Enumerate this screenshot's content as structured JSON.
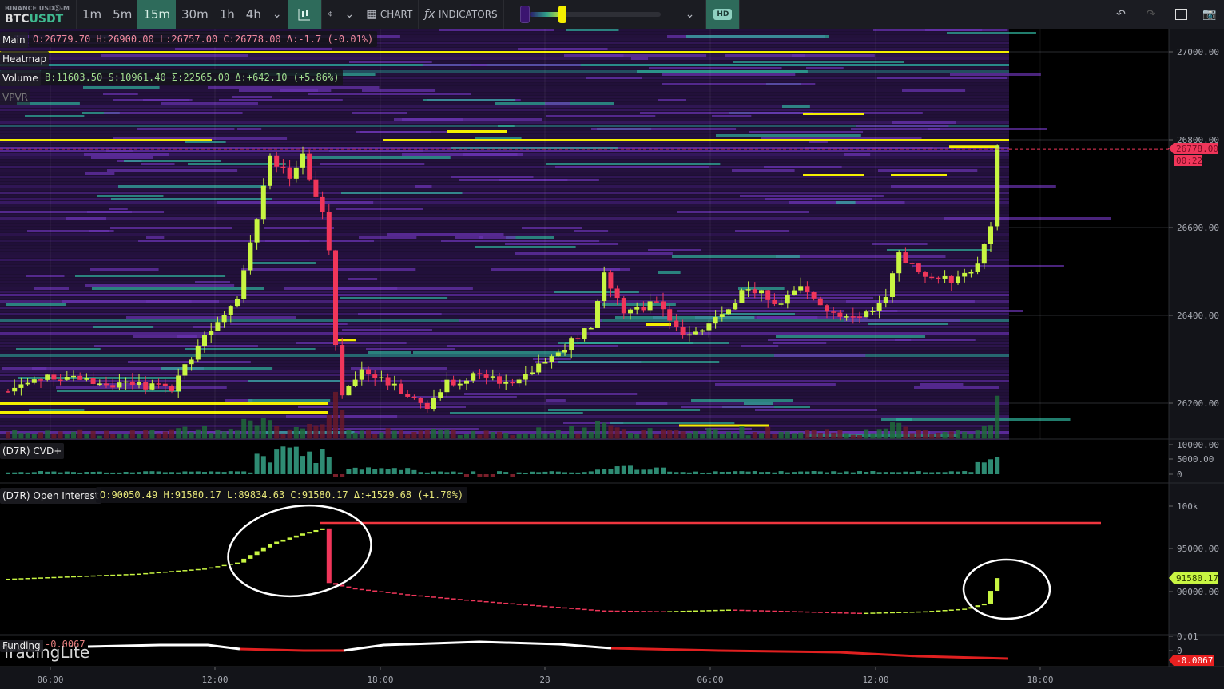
{
  "toolbar": {
    "exchange": "BINANCE USDⓈ-M",
    "symbol_base": "BTC",
    "symbol_quote": "USDT",
    "timeframes": [
      "1m",
      "5m",
      "15m",
      "30m",
      "1h",
      "4h"
    ],
    "active_timeframe": "15m",
    "chart_label": "CHART",
    "indicators_label": "INDICATORS",
    "hd_label": "HD",
    "heatmap_slider_value": 0.25
  },
  "main": {
    "label": "Main",
    "ohlc": "O:26779.70 H:26900.00 L:26757.00 C:26778.00 Δ:-1.7 (-0.01%)",
    "heatmap_label": "Heatmap",
    "volume_label": "Volume",
    "volume_values": "B:11603.50 S:10961.40 Σ:22565.00 Δ:+642.10 (+5.86%)",
    "vpvr_label": "VPVR",
    "price_ticks": [
      "27000.00",
      "26800.00",
      "26600.00",
      "26400.00",
      "26200.00"
    ],
    "last_price": "26778.00",
    "countdown": "00:22",
    "price_keypoints": [
      [
        0,
        26227
      ],
      [
        6,
        26264
      ],
      [
        17,
        26242
      ],
      [
        25,
        26236
      ],
      [
        30,
        26355
      ],
      [
        35,
        26445
      ],
      [
        38,
        26627
      ],
      [
        40,
        26755
      ],
      [
        43,
        26718
      ],
      [
        45,
        26760
      ],
      [
        48,
        26627
      ],
      [
        49,
        26555
      ],
      [
        50,
        26336
      ],
      [
        51,
        26209
      ],
      [
        54,
        26282
      ],
      [
        60,
        26227
      ],
      [
        64,
        26190
      ],
      [
        67,
        26245
      ],
      [
        72,
        26264
      ],
      [
        77,
        26245
      ],
      [
        84,
        26318
      ],
      [
        89,
        26373
      ],
      [
        91,
        26500
      ],
      [
        94,
        26409
      ],
      [
        99,
        26427
      ],
      [
        103,
        26355
      ],
      [
        107,
        26373
      ],
      [
        113,
        26464
      ],
      [
        118,
        26427
      ],
      [
        121,
        26464
      ],
      [
        125,
        26409
      ],
      [
        130,
        26391
      ],
      [
        134,
        26445
      ],
      [
        136,
        26536
      ],
      [
        140,
        26482
      ],
      [
        145,
        26482
      ],
      [
        148,
        26518
      ],
      [
        150,
        26609
      ],
      [
        151,
        26778
      ]
    ]
  },
  "cvd": {
    "label": "(D7R) CVD+",
    "ticks": [
      "10000.00",
      "5000.00",
      "0"
    ]
  },
  "oi": {
    "label": "(D7R) Open Interest",
    "values": "O:90050.49 H:91580.17 L:89834.63 C:91580.17 Δ:+1529.68 (+1.70%)",
    "ticks": [
      "100k",
      "95000.00",
      "90000.00"
    ],
    "last": "91580.17",
    "keypoints": [
      [
        0,
        91500
      ],
      [
        20,
        92100
      ],
      [
        30,
        92700
      ],
      [
        35,
        93400
      ],
      [
        40,
        95600
      ],
      [
        45,
        96800
      ],
      [
        48,
        97400
      ],
      [
        49,
        91000
      ],
      [
        52,
        90400
      ],
      [
        60,
        89700
      ],
      [
        70,
        89000
      ],
      [
        80,
        88400
      ],
      [
        90,
        87800
      ],
      [
        100,
        87700
      ],
      [
        110,
        87900
      ],
      [
        120,
        87700
      ],
      [
        130,
        87500
      ],
      [
        140,
        87700
      ],
      [
        146,
        88000
      ],
      [
        149,
        88600
      ],
      [
        151,
        91580
      ]
    ]
  },
  "funding": {
    "label": "Funding",
    "value": "-0.0067",
    "ticks": [
      "0.01",
      "0"
    ],
    "last": "-0.0067"
  },
  "time_ticks": [
    "06:00",
    "12:00",
    "18:00",
    "28",
    "06:00",
    "12:00",
    "18:00"
  ],
  "watermark": "TradingLite",
  "colors": {
    "up": "#c8f542",
    "down": "#f0365a",
    "accent": "#2e6b5b",
    "level": "#f4ef00"
  }
}
